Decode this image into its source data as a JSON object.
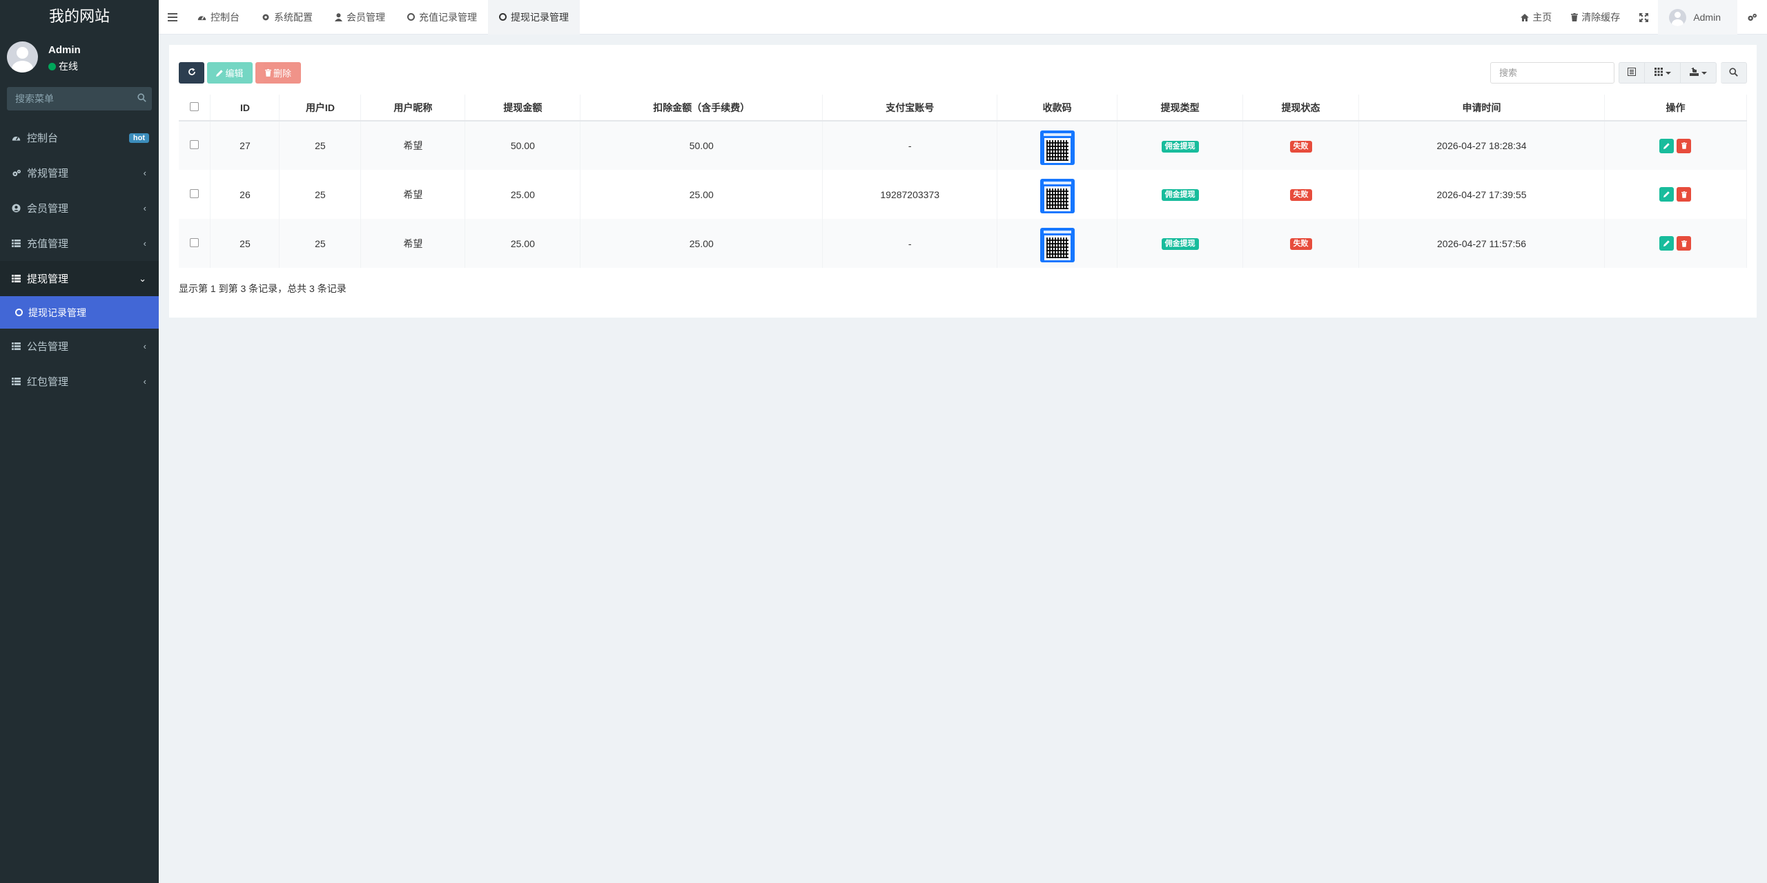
{
  "sidebar": {
    "logo": "我的网站",
    "user": {
      "name": "Admin",
      "status": "在线"
    },
    "search_placeholder": "搜索菜单",
    "items": [
      {
        "label": "控制台",
        "icon": "dashboard-icon",
        "badge": "hot"
      },
      {
        "label": "常规管理",
        "icon": "cogs-icon"
      },
      {
        "label": "会员管理",
        "icon": "user-circle-icon"
      },
      {
        "label": "充值管理",
        "icon": "list-icon"
      },
      {
        "label": "提现管理",
        "icon": "list-icon",
        "active": true
      },
      {
        "label": "提现记录管理",
        "icon": "circle-icon",
        "sub": true
      },
      {
        "label": "公告管理",
        "icon": "list-icon"
      },
      {
        "label": "红包管理",
        "icon": "list-icon"
      }
    ]
  },
  "topbar": {
    "tabs": [
      {
        "label": "控制台",
        "icon": "dashboard-icon"
      },
      {
        "label": "系统配置",
        "icon": "gear-icon"
      },
      {
        "label": "会员管理",
        "icon": "user-icon"
      },
      {
        "label": "充值记录管理",
        "icon": "circle-icon"
      },
      {
        "label": "提现记录管理",
        "icon": "circle-icon",
        "active": true
      }
    ],
    "home": "主页",
    "clear_cache": "清除缓存",
    "user_name": "Admin"
  },
  "toolbar": {
    "edit_label": "编辑",
    "delete_label": "删除",
    "search_placeholder": "搜索"
  },
  "table": {
    "headers": [
      "ID",
      "用户ID",
      "用户昵称",
      "提现金额",
      "扣除金额（含手续费）",
      "支付宝账号",
      "收款码",
      "提现类型",
      "提现状态",
      "申请时间",
      "操作"
    ],
    "rows": [
      {
        "id": "27",
        "user_id": "25",
        "nickname": "希望",
        "amount": "50.00",
        "deduct": "50.00",
        "alipay": "-",
        "type": "佣金提现",
        "status": "失败",
        "time": "2026-04-27 18:28:34"
      },
      {
        "id": "26",
        "user_id": "25",
        "nickname": "希望",
        "amount": "25.00",
        "deduct": "25.00",
        "alipay": "19287203373",
        "type": "佣金提现",
        "status": "失败",
        "time": "2026-04-27 17:39:55"
      },
      {
        "id": "25",
        "user_id": "25",
        "nickname": "希望",
        "amount": "25.00",
        "deduct": "25.00",
        "alipay": "-",
        "type": "佣金提现",
        "status": "失败",
        "time": "2026-04-27 11:57:56"
      }
    ]
  },
  "pagination": {
    "info": "显示第 1 到第 3 条记录，总共 3 条记录"
  },
  "colors": {
    "sidebar_bg": "#222d32",
    "submenu_active": "#4267d6",
    "success": "#18bc9c",
    "danger": "#e74c3c",
    "primary_dark": "#2c3e50"
  }
}
